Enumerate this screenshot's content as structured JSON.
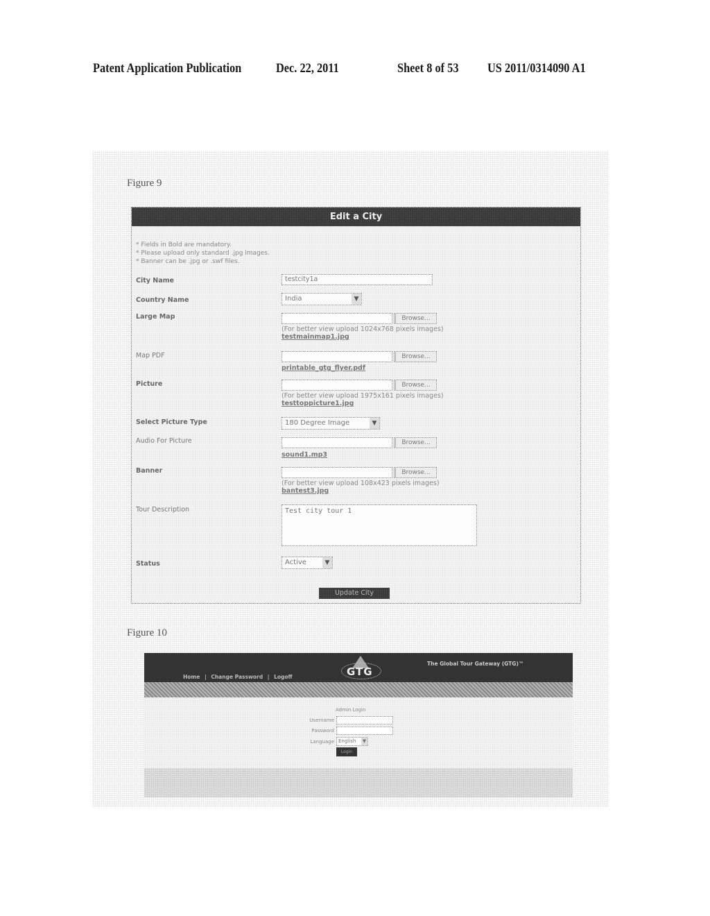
{
  "patent_header": {
    "title": "Patent Application Publication",
    "date": "Dec. 22, 2011",
    "sheet": "Sheet 8 of 53",
    "number": "US 2011/0314090 A1"
  },
  "figure9": {
    "label": "Figure 9",
    "form_title": "Edit a City",
    "notes": [
      "* Fields in Bold are mandatory.",
      "* Please upload only standard .jpg images.",
      "* Banner can be .jpg or .swf files."
    ],
    "fields": {
      "city_name": {
        "label": "City Name",
        "value": "testcity1a"
      },
      "country_name": {
        "label": "Country Name",
        "selected": "India"
      },
      "large_map": {
        "label": "Large Map",
        "browse": "Browse...",
        "hint": "(For better view upload 1024x768 pixels images)",
        "file": "testmainmap1.jpg"
      },
      "map_pdf": {
        "label": "Map PDF",
        "browse": "Browse...",
        "file": "printable_gtg_flyer.pdf"
      },
      "picture": {
        "label": "Picture",
        "browse": "Browse...",
        "hint": "(For better view upload 1975x161 pixels images)",
        "file": "testtoppicture1.jpg"
      },
      "picture_type": {
        "label": "Select Picture Type",
        "selected": "180 Degree Image"
      },
      "audio": {
        "label": "Audio For Picture",
        "browse": "Browse...",
        "file": "sound1.mp3"
      },
      "banner": {
        "label": "Banner",
        "browse": "Browse...",
        "hint": "(For better view upload 108x423 pixels images)",
        "file": "bantest3.jpg"
      },
      "tour_description": {
        "label": "Tour Description",
        "value": "Test city tour 1"
      },
      "status": {
        "label": "Status",
        "selected": "Active"
      }
    },
    "submit_label": "Update City"
  },
  "figure10": {
    "label": "Figure 10",
    "nav": [
      "Home",
      "|",
      "Change Password",
      "|",
      "Logoff"
    ],
    "logo_text": "GTG",
    "brand": "The Global Tour Gateway (GTG)™",
    "login_title": "Admin Login",
    "username_label": "Username",
    "password_label": "Password",
    "language_label": "Language",
    "language_selected": "English",
    "login_button": "Login"
  }
}
